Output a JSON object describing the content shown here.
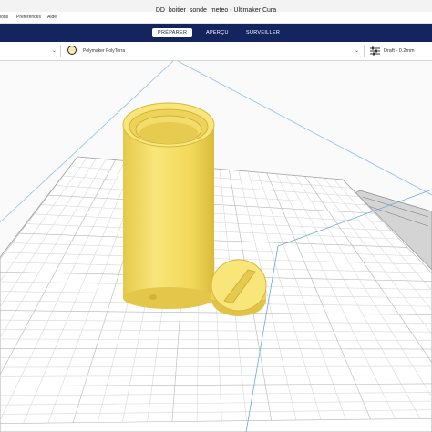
{
  "window": {
    "title": "DD_boitier_sonde_meteo - Ultimaker Cura"
  },
  "menu": {
    "items": [
      "ions",
      "Préférences",
      "Aide"
    ]
  },
  "stages": [
    {
      "label": "PRÉPARER",
      "active": true
    },
    {
      "label": "APERÇU",
      "active": false
    },
    {
      "label": "SURVEILLER",
      "active": false
    }
  ],
  "toolbar": {
    "material_label": "Polymaker PolyTerra",
    "profile_label": "Draft - 0.2mm"
  },
  "icons": [
    "chevron-down-icon",
    "material-icon",
    "print-settings-icon"
  ],
  "colors": {
    "header": "#13245e",
    "model": "#f7e46b",
    "build_plate": "#ffffff",
    "grid": "#c9c9c9",
    "axis_line": "#6aa6e6"
  }
}
